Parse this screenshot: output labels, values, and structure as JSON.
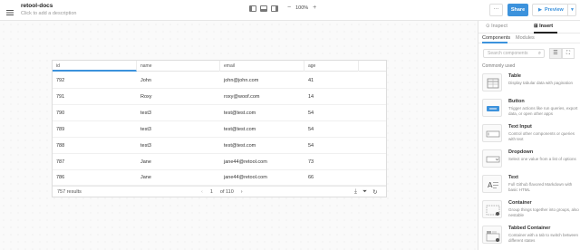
{
  "topbar": {
    "app_title": "retool-docs",
    "app_description_placeholder": "Click to add a description",
    "zoom_level": "100%",
    "zoom_out": "−",
    "zoom_in": "+",
    "more_label": "···",
    "share_label": "Share",
    "preview_label": "Preview"
  },
  "table": {
    "columns": [
      "id",
      "name",
      "email",
      "age"
    ],
    "rows": [
      {
        "id": "792",
        "name": "John",
        "email": "john@john.com",
        "age": "41"
      },
      {
        "id": "791",
        "name": "Roxy",
        "email": "roxy@woof.com",
        "age": "14"
      },
      {
        "id": "790",
        "name": "test3",
        "email": "test@test.com",
        "age": "54"
      },
      {
        "id": "789",
        "name": "test3",
        "email": "test@test.com",
        "age": "54"
      },
      {
        "id": "788",
        "name": "test3",
        "email": "test@test.com",
        "age": "54"
      },
      {
        "id": "787",
        "name": "Jane",
        "email": "jane44@retool.com",
        "age": "73"
      },
      {
        "id": "786",
        "name": "Jane",
        "email": "jane44@retool.com",
        "age": "66"
      }
    ],
    "results_count": "757 results",
    "page_current": "1",
    "page_total": "of 110",
    "prev": "‹",
    "next": "›"
  },
  "panel": {
    "tabs": [
      "Inspect",
      "Insert"
    ],
    "active_tab": "Insert",
    "subtabs": [
      "Components",
      "Modules"
    ],
    "search_placeholder": "Search components",
    "section_label": "Commonly used",
    "components": [
      {
        "name": "Table",
        "description": "Display tabular data with pagination"
      },
      {
        "name": "Button",
        "description": "Trigger actions like run queries, export data, or open other apps"
      },
      {
        "name": "Text Input",
        "description": "Control other components or queries with text"
      },
      {
        "name": "Dropdown",
        "description": "Select one value from a list of options"
      },
      {
        "name": "Text",
        "description": "Full Github flavored Markdown with basic HTML"
      },
      {
        "name": "Container",
        "description": "Group things together into groups, also nestable"
      },
      {
        "name": "Tabbed Container",
        "description": "Container with a tab to switch between different states"
      }
    ]
  },
  "colors": {
    "accent": "#3c92dc"
  }
}
